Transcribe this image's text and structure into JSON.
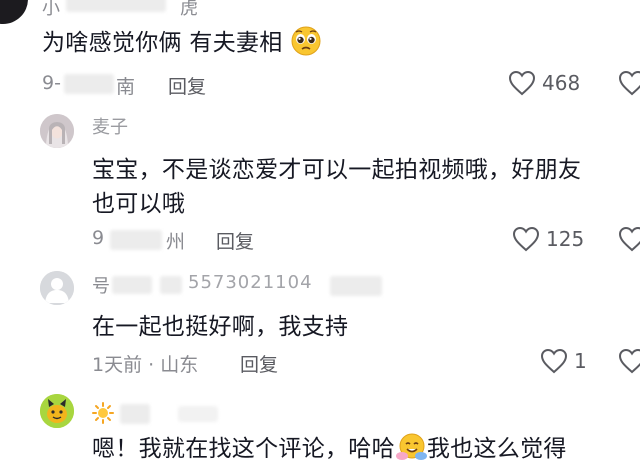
{
  "comments": [
    {
      "id": "c1",
      "username": "小",
      "username_tail": "虎",
      "content": "为啥感觉你俩 有夫妻相",
      "content_emoji": "pleading-face-emoji",
      "meta_prefix": "9-",
      "meta_location": "南",
      "reply_label": "回复",
      "likes": "468"
    },
    {
      "id": "c2",
      "username": "麦子",
      "content_line1": "宝宝，不是谈恋爱才可以一起拍视频哦，好朋友",
      "content_line2": "也可以哦",
      "meta_prefix": "9",
      "meta_location": "州",
      "reply_label": "回复",
      "likes": "125"
    },
    {
      "id": "c3",
      "username": "号",
      "username_id": "5573021104",
      "content": "在一起也挺好啊，我支持",
      "meta": "1天前 · 山东",
      "reply_label": "回复",
      "likes": "1"
    },
    {
      "id": "c4",
      "username_emoji": "sun-emoji",
      "content_part1": "嗯！我就在找这个评论，哈哈",
      "content_emoji": "hugging-face-emoji",
      "content_part2": "我也这么觉得"
    }
  ],
  "colors": {
    "text": "#161823",
    "meta": "#8a8b91",
    "action": "#5a5b61",
    "background": "#ffffff"
  }
}
